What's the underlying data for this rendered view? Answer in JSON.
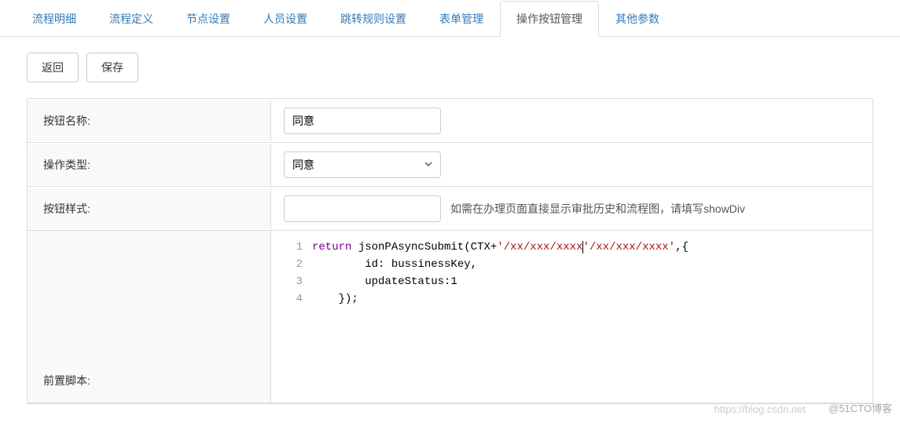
{
  "tabs": [
    {
      "label": "流程明细",
      "active": false
    },
    {
      "label": "流程定义",
      "active": false
    },
    {
      "label": "节点设置",
      "active": false
    },
    {
      "label": "人员设置",
      "active": false
    },
    {
      "label": "跳转规则设置",
      "active": false
    },
    {
      "label": "表单管理",
      "active": false
    },
    {
      "label": "操作按钮管理",
      "active": true
    },
    {
      "label": "其他参数",
      "active": false
    }
  ],
  "toolbar": {
    "back_label": "返回",
    "save_label": "保存"
  },
  "form": {
    "button_name_label": "按钮名称:",
    "button_name_value": "同意",
    "operation_type_label": "操作类型:",
    "operation_type_value": "同意",
    "button_style_label": "按钮样式:",
    "button_style_value": "",
    "button_style_hint": "如需在办理页面直接显示审批历史和流程图，请填写showDiv",
    "pre_script_label": "前置脚本:"
  },
  "code": {
    "lines": [
      {
        "n": "1",
        "segments": [
          {
            "t": "return ",
            "c": "kw"
          },
          {
            "t": "jsonPAsyncSubmit",
            "c": "fn"
          },
          {
            "t": "(CTX+",
            "c": "var"
          },
          {
            "t": "'/xx/xxx/xxxx'",
            "c": "str"
          },
          {
            "t": ",{",
            "c": "var"
          }
        ]
      },
      {
        "n": "2",
        "segments": [
          {
            "t": "        id: bussinessKey,",
            "c": "var"
          }
        ]
      },
      {
        "n": "3",
        "segments": [
          {
            "t": "        updateStatus:1",
            "c": "var"
          }
        ]
      },
      {
        "n": "4",
        "segments": [
          {
            "t": "    });",
            "c": "var"
          }
        ]
      }
    ]
  },
  "watermark1": "https://blog.csdn.net",
  "watermark2": "@51CTO博客"
}
